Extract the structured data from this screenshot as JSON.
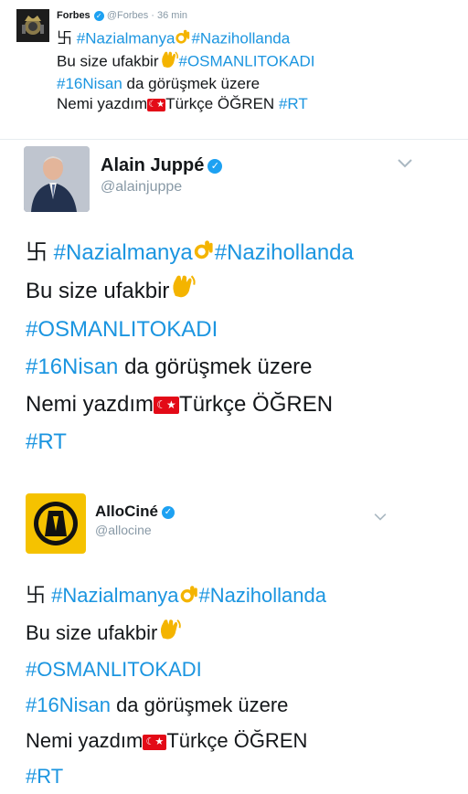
{
  "forbes": {
    "name": "Forbes",
    "handle": "@Forbes",
    "time": "· 36 min",
    "line1": {
      "swastika": "卐",
      "tag1": "#Nazialmanya",
      "tag2": "#Nazihollanda"
    },
    "line2": {
      "text": "Bu size ufakbir",
      "tag": "#OSMANLITOKADI"
    },
    "line3": {
      "tag": "#16Nisan",
      "text": " da görüşmek üzere"
    },
    "line4": {
      "text1": "Nemi yazdım",
      "text2": "Türkçe ÖĞREN ",
      "tag": "#RT"
    }
  },
  "juppe": {
    "name": "Alain Juppé",
    "handle": "@alainjuppe",
    "chevron": "⌄",
    "line1": {
      "swastika": "卐",
      "tag1": "#Nazialmanya",
      "tag2": "#Nazihollanda"
    },
    "line2": {
      "text": "Bu size ufakbir"
    },
    "line3": {
      "tag": "#OSMANLITOKADI"
    },
    "line4": {
      "tag": "#16Nisan",
      "text": " da görüşmek üzere"
    },
    "line5": {
      "text1": "Nemi yazdım",
      "text2": "Türkçe ÖĞREN"
    },
    "line6": {
      "tag": "#RT"
    }
  },
  "allocine": {
    "name": "AlloCiné",
    "handle": "@allocine",
    "chevron": "⌄",
    "line1": {
      "swastika": "卐",
      "tag1": "#Nazialmanya",
      "tag2": "#Nazihollanda"
    },
    "line2": {
      "text": "Bu size ufakbir"
    },
    "line3": {
      "tag": "#OSMANLITOKADI"
    },
    "line4": {
      "tag": "#16Nisan",
      "text": " da görüşmek üzere"
    },
    "line5": {
      "text1": "Nemi yazdım",
      "text2": "Türkçe ÖĞREN"
    },
    "line6": {
      "tag": "#RT"
    }
  },
  "icons": {
    "verified": "✓",
    "ok_hand": "ok-hand-emoji",
    "wave": "waving-hand-emoji",
    "flag": "turkey-flag-emoji"
  },
  "colors": {
    "hashtag": "#1b95e0",
    "verified": "#1da1f2",
    "allocine_yellow": "#f5c200"
  }
}
